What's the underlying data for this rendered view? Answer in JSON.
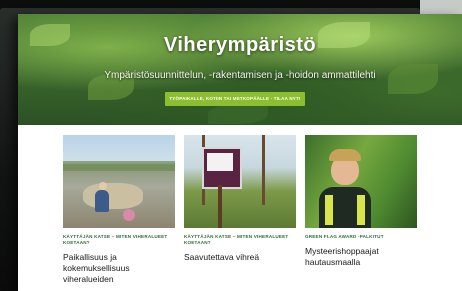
{
  "hero": {
    "title": "Viherympäristö",
    "subtitle": "Ympäristösuunnittelun, -rakentamisen ja -hoidon ammattilehti",
    "cta_label": "TYÖPAIKALLE, KOTIIN TAI METKOPÄÄLLE · TILAA NYT!"
  },
  "cards": [
    {
      "category": "Käyttäjän katse – miten viheralueet koetaan?",
      "title": "Paikallisuus ja kokemuksellisuus viheralueiden"
    },
    {
      "category": "Käyttäjän katse – miten viheralueet koetaan?",
      "title": "Saavutettava vihreä"
    },
    {
      "category": "Green Flag Award -palkitut",
      "title": "Mysteerishoppaajat hautausmaalla"
    }
  ],
  "colors": {
    "accent": "#8bbf2f",
    "category_text": "#2f6b3a"
  }
}
